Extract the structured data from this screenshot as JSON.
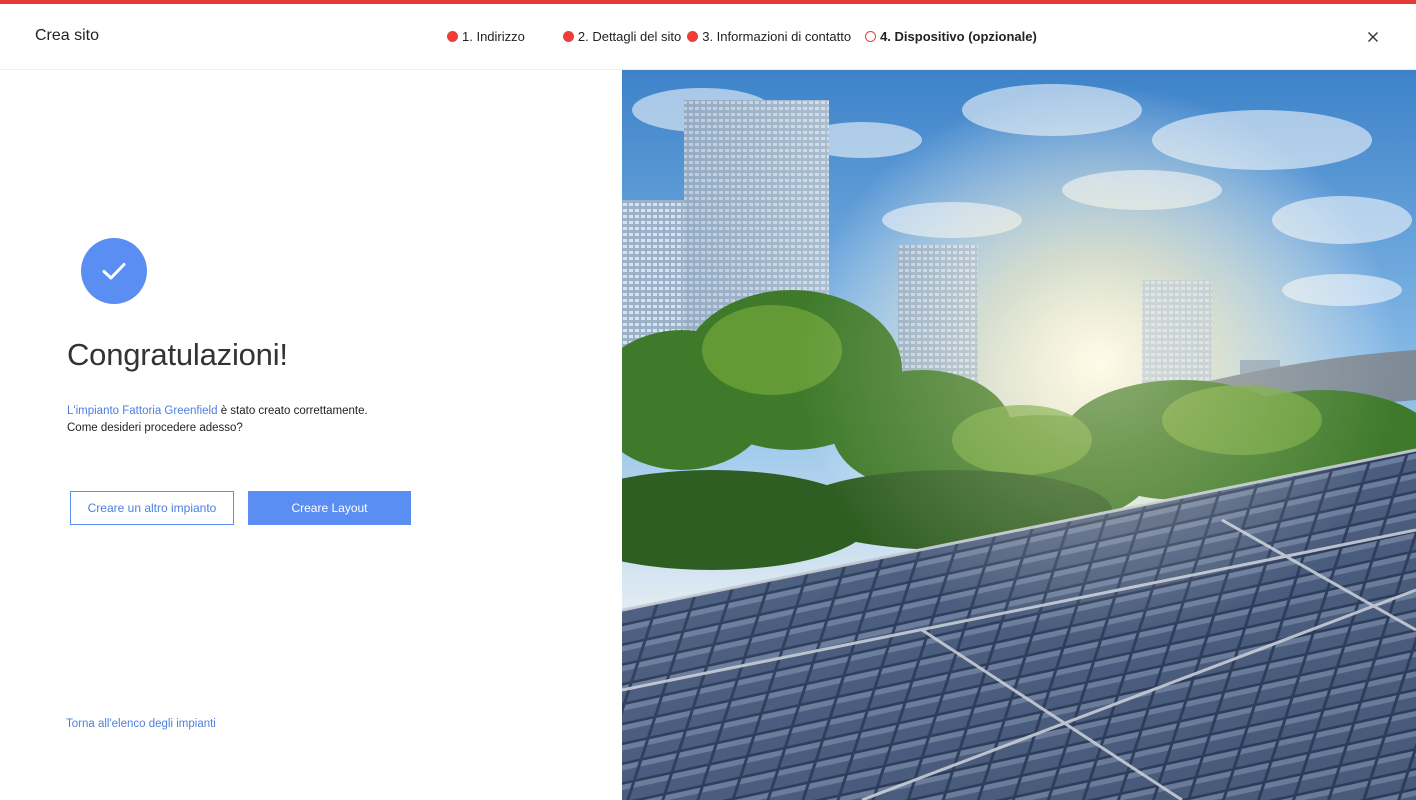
{
  "header": {
    "title": "Crea sito",
    "steps": [
      {
        "label": "1. Indirizzo",
        "state": "complete"
      },
      {
        "label": "2. Dettagli del sito",
        "state": "complete"
      },
      {
        "label": "3. Informazioni di contatto",
        "state": "complete"
      },
      {
        "label": "4. Dispositivo (opzionale)",
        "state": "current"
      }
    ],
    "close_icon": "close-icon"
  },
  "main": {
    "status_icon": "check-circle-icon",
    "headline": "Congratulazioni!",
    "message": {
      "site_link": "L'impianto Fattoria Greenfield",
      "rest": " è stato creato correttamente.",
      "question": "Come desideri procedere adesso?"
    },
    "buttons": {
      "create_another": "Creare un altro impianto",
      "create_layout": "Creare Layout"
    },
    "back_link": "Torna all'elenco degli impianti"
  },
  "colors": {
    "accent": "#5b8ef3",
    "step_red": "#f23c3c",
    "top_line": "#e53935",
    "link": "#4d7fe0"
  }
}
